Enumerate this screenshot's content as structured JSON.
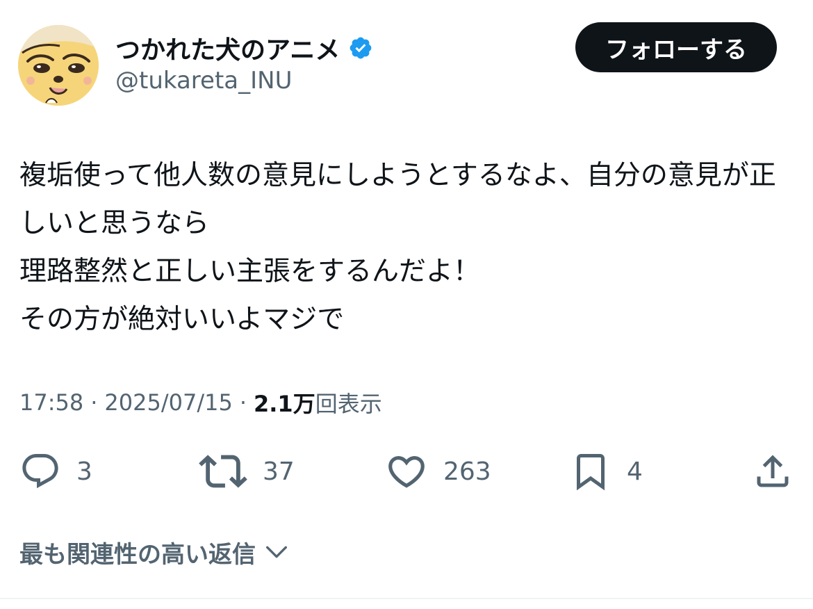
{
  "author": {
    "display_name": "つかれた犬のアニメ",
    "handle": "@tukareta_INU",
    "verified": true,
    "avatar_icon": "cartoon-dog-avatar",
    "verified_icon": "verified-badge-icon",
    "verified_color": "#1d9bf0"
  },
  "follow_button": {
    "label": "フォローする",
    "background": "#0f1419",
    "text_color": "#ffffff"
  },
  "tweet": {
    "text": "複垢使って他人数の意見にしようとするなよ、自分の意見が正しいと思うなら\n理路整然と正しい主張をするんだよ！\nその方が絶対いいよマジで"
  },
  "meta": {
    "time": "17:58",
    "separator": "·",
    "date": "2025/07/15",
    "views_count": "2.1万",
    "views_label": "回表示"
  },
  "actions": {
    "reply": {
      "icon": "reply-icon",
      "count": "3"
    },
    "retweet": {
      "icon": "retweet-icon",
      "count": "37"
    },
    "like": {
      "icon": "heart-icon",
      "count": "263"
    },
    "bookmark": {
      "icon": "bookmark-icon",
      "count": "4"
    },
    "share": {
      "icon": "share-icon"
    }
  },
  "replies_filter": {
    "label": "最も関連性の高い返信",
    "icon": "chevron-down-icon"
  },
  "colors": {
    "primary_text": "#0f1419",
    "secondary_text": "#536471",
    "divider": "#eff3f4"
  }
}
